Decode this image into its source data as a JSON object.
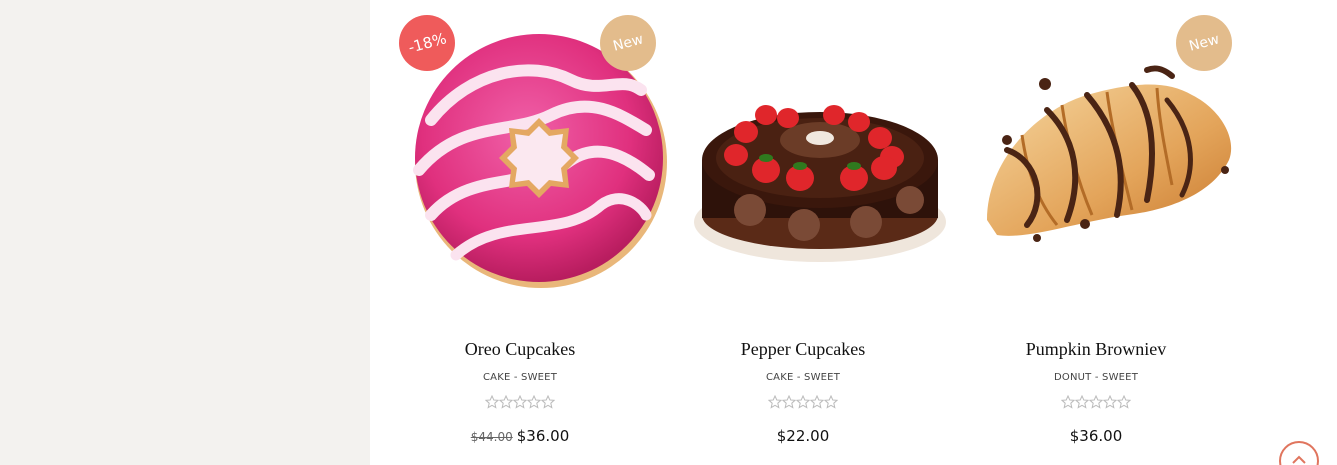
{
  "products": [
    {
      "title": "Oreo Cupcakes",
      "categories": "CAKE - SWEET",
      "old_price": "$44.00",
      "price": "$36.00",
      "sale_badge": "-18%",
      "new_badge": "New",
      "rating": 0,
      "image": "pink-donut-image"
    },
    {
      "title": "Pepper Cupcakes",
      "categories": "CAKE - SWEET",
      "price": "$22.00",
      "rating": 0,
      "image": "chocolate-strawberry-cake-image"
    },
    {
      "title": "Pumpkin Browniev",
      "categories": "DONUT - SWEET",
      "price": "$36.00",
      "new_badge": "New",
      "rating": 0,
      "image": "chocolate-croissant-image"
    }
  ],
  "colors": {
    "sale_badge": "#ef5b5b",
    "new_badge": "#e3bc8c",
    "scroll_top_accent": "#e0755e",
    "left_panel": "#f3f2ef"
  },
  "icons": {
    "star": "star-outline-icon",
    "scroll_top": "chevron-up-icon"
  }
}
